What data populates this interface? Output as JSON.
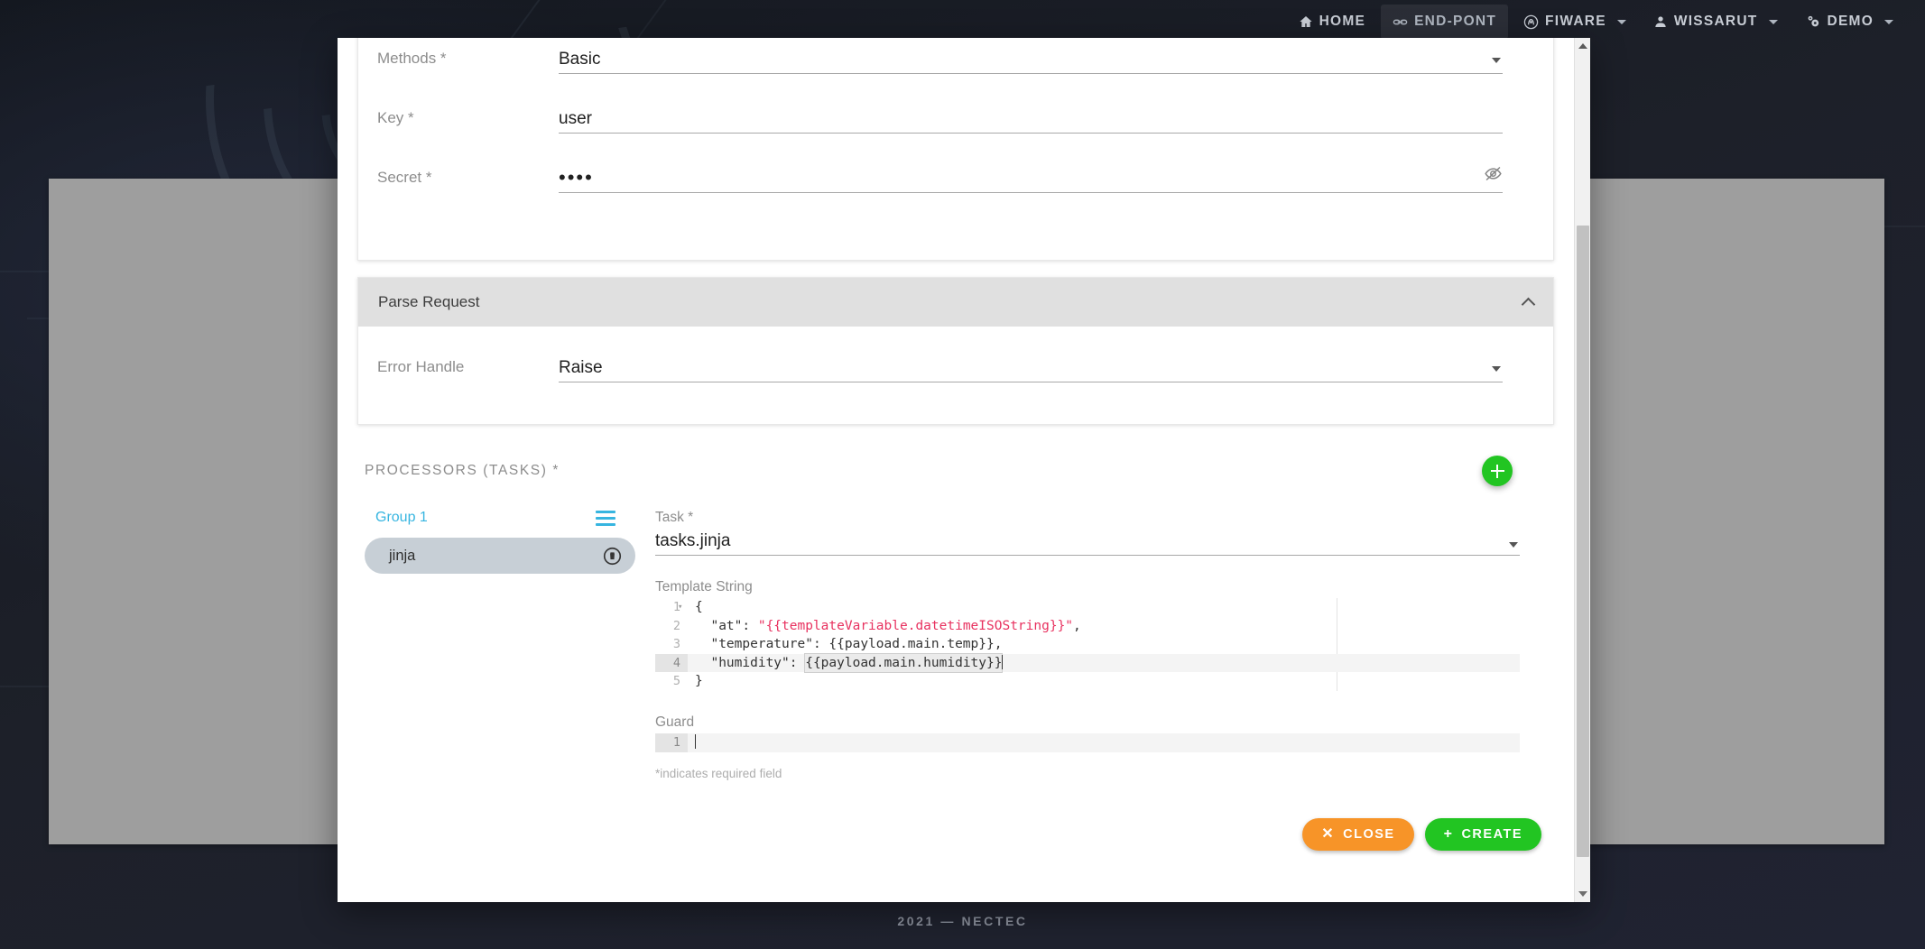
{
  "topnav": {
    "items": [
      {
        "label": "HOME",
        "icon": "home-icon",
        "active": false,
        "caret": false
      },
      {
        "label": "END-PONT",
        "icon": "link-icon",
        "active": true,
        "caret": false
      },
      {
        "label": "FIWARE",
        "icon": "fiware-icon",
        "active": false,
        "caret": true
      },
      {
        "label": "WISSARUT",
        "icon": "person-icon",
        "active": false,
        "caret": true
      },
      {
        "label": "DEMO",
        "icon": "settings-gears-icon",
        "active": false,
        "caret": true
      }
    ]
  },
  "page_footer": {
    "copyright": "2021 — NECTEC"
  },
  "modal": {
    "auth_card": {
      "fields": [
        {
          "label": "Methods *",
          "value": "Basic",
          "type": "select"
        },
        {
          "label": "Key *",
          "value": "user",
          "type": "text"
        },
        {
          "label": "Secret *",
          "value": "••••",
          "type": "password",
          "trailing_icon": "eye-off-icon"
        }
      ]
    },
    "parse_request": {
      "header_title": "Parse Request",
      "collapse_icon": "chevron-up-icon",
      "error_handle": {
        "label": "Error Handle",
        "value": "Raise",
        "type": "select"
      }
    },
    "processors": {
      "section_title": "PROCESSORS (TASKS) *",
      "add_button_icon": "plus-icon",
      "group": {
        "name": "Group 1",
        "menu_icon": "hamburger-icon",
        "tasks": [
          {
            "name": "jinja",
            "delete_icon": "trash-icon",
            "selected": true
          }
        ]
      },
      "detail": {
        "task_field": {
          "label": "Task *",
          "value": "tasks.jinja",
          "type": "select"
        },
        "template_string": {
          "label": "Template String",
          "lines": [
            {
              "n": "1",
              "fold": true,
              "segments": [
                {
                  "t": "{",
                  "c": "plain"
                }
              ]
            },
            {
              "n": "2",
              "fold": false,
              "segments": [
                {
                  "t": "  \"at\": ",
                  "c": "plain"
                },
                {
                  "t": "\"{{templateVariable.datetimeISOString}}\"",
                  "c": "pink"
                },
                {
                  "t": ",",
                  "c": "plain"
                }
              ]
            },
            {
              "n": "3",
              "fold": false,
              "segments": [
                {
                  "t": "  \"temperature\": {{payload.main.temp}},",
                  "c": "plain"
                }
              ]
            },
            {
              "n": "4",
              "fold": false,
              "active": true,
              "segments": [
                {
                  "t": "  \"humidity\": ",
                  "c": "plain"
                },
                {
                  "t": "{{payload.main.humidity}}",
                  "c": "boxed"
                }
              ]
            },
            {
              "n": "5",
              "fold": false,
              "segments": [
                {
                  "t": "}",
                  "c": "plain"
                }
              ]
            }
          ]
        },
        "guard": {
          "label": "Guard",
          "lines": [
            {
              "n": "1",
              "text": ""
            }
          ]
        }
      }
    },
    "required_note": "*indicates required field",
    "footer": {
      "close_button": {
        "label": "CLOSE",
        "glyph": "✕",
        "icon": "close-icon"
      },
      "create_button": {
        "label": "CREATE",
        "glyph": "+",
        "icon": "plus-icon"
      }
    }
  },
  "colors": {
    "accent_cyan": "#37b5e0",
    "green": "#22c522",
    "orange": "#f79428",
    "panel_gray": "#9e9e9e",
    "code_pink": "#e8315f"
  }
}
